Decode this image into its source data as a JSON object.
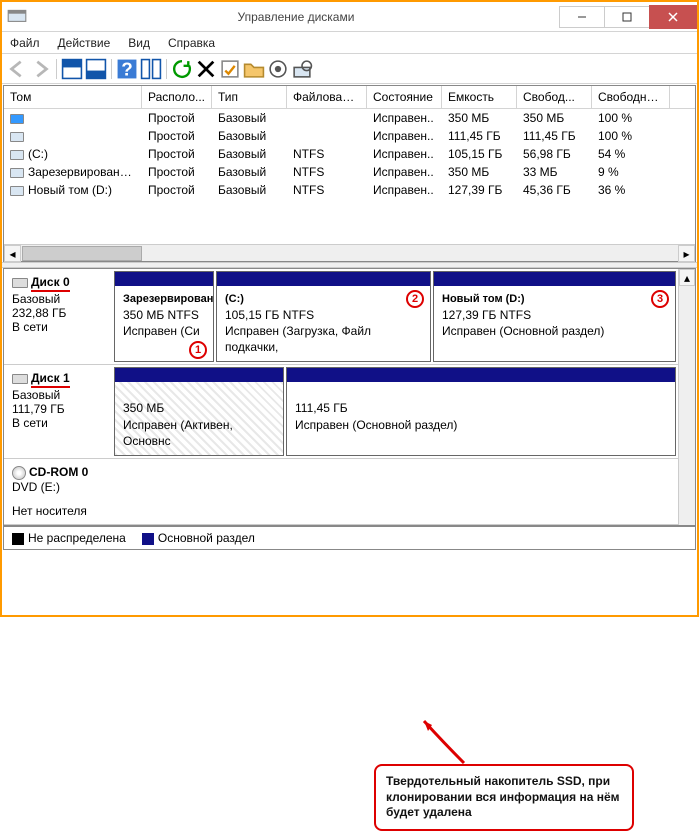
{
  "window": {
    "title": "Управление дисками"
  },
  "menu": {
    "file": "Файл",
    "action": "Действие",
    "view": "Вид",
    "help": "Справка"
  },
  "columns": {
    "volume": "Том",
    "layout": "Располо...",
    "type": "Тип",
    "fs": "Файловая с...",
    "status": "Состояние",
    "capacity": "Емкость",
    "free": "Свобод...",
    "freepct": "Свободно %"
  },
  "rows": [
    {
      "vol": "",
      "layout": "Простой",
      "type": "Базовый",
      "fs": "",
      "status": "Исправен..",
      "cap": "350 МБ",
      "free": "350 МБ",
      "pct": "100 %",
      "sel": true,
      "icon": true
    },
    {
      "vol": "",
      "layout": "Простой",
      "type": "Базовый",
      "fs": "",
      "status": "Исправен..",
      "cap": "111,45 ГБ",
      "free": "111,45 ГБ",
      "pct": "100 %",
      "icon": true
    },
    {
      "vol": "(C:)",
      "layout": "Простой",
      "type": "Базовый",
      "fs": "NTFS",
      "status": "Исправен..",
      "cap": "105,15 ГБ",
      "free": "56,98 ГБ",
      "pct": "54 %",
      "icon": true
    },
    {
      "vol": "Зарезервировано…",
      "layout": "Простой",
      "type": "Базовый",
      "fs": "NTFS",
      "status": "Исправен..",
      "cap": "350 МБ",
      "free": "33 МБ",
      "pct": "9 %",
      "icon": true
    },
    {
      "vol": "Новый том (D:)",
      "layout": "Простой",
      "type": "Базовый",
      "fs": "NTFS",
      "status": "Исправен..",
      "cap": "127,39 ГБ",
      "free": "45,36 ГБ",
      "pct": "36 %",
      "icon": true
    }
  ],
  "disk0": {
    "name": "Диск 0",
    "type": "Базовый",
    "size": "232,88 ГБ",
    "status": "В сети",
    "p1": {
      "t": "Зарезервирован",
      "s": "350 МБ NTFS",
      "st": "Исправен (Си"
    },
    "p2": {
      "t": "(C:)",
      "s": "105,15 ГБ NTFS",
      "st": "Исправен (Загрузка, Файл подкачки,"
    },
    "p3": {
      "t": "Новый том (D:)",
      "s": "127,39 ГБ NTFS",
      "st": "Исправен (Основной раздел)"
    }
  },
  "disk1": {
    "name": "Диск 1",
    "type": "Базовый",
    "size": "111,79 ГБ",
    "status": "В сети",
    "p1": {
      "s": "350 МБ",
      "st": "Исправен (Активен, Основнс"
    },
    "p2": {
      "s": "111,45 ГБ",
      "st": "Исправен (Основной раздел)"
    }
  },
  "cdrom": {
    "name": "CD-ROM 0",
    "dev": "DVD (E:)",
    "status": "Нет носителя"
  },
  "legend": {
    "unalloc": "Не распределена",
    "primary": "Основной раздел"
  },
  "callout": {
    "text": "Твердотельный накопитель SSD, при клонировании вся информация на нём будет удалена"
  },
  "nums": {
    "n1": "1",
    "n2": "2",
    "n3": "3"
  }
}
